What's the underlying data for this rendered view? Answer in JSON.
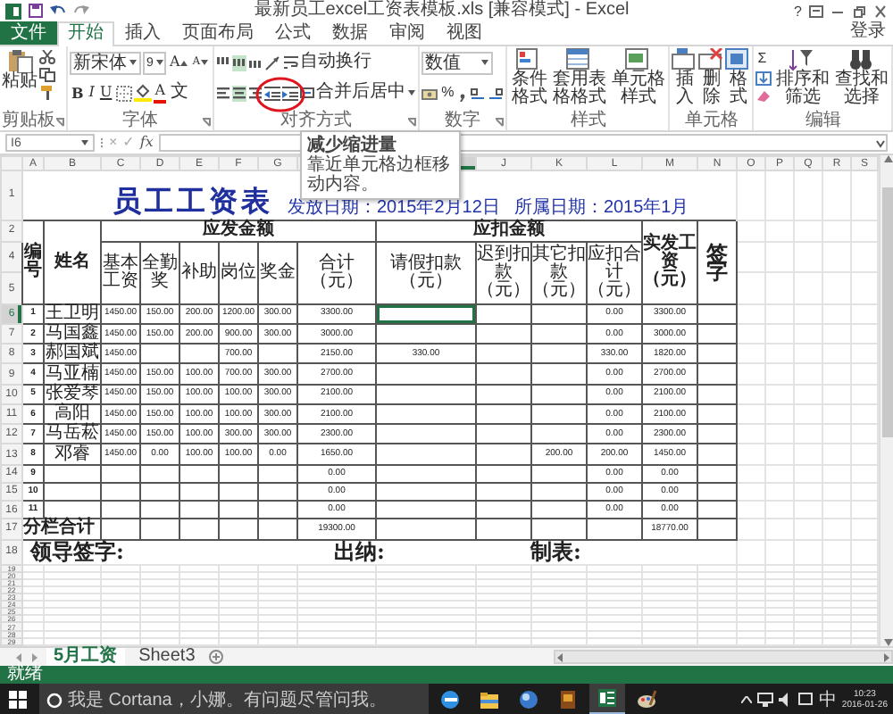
{
  "window": {
    "title": "最新员工excel工资表模板.xls [兼容模式] - Excel",
    "help": "?",
    "sign_in": "登录"
  },
  "ribbon_tabs": [
    {
      "label": "文件",
      "kind": "file",
      "selected": false
    },
    {
      "label": "开始",
      "kind": "tab",
      "selected": true
    },
    {
      "label": "插入",
      "kind": "tab",
      "selected": false
    },
    {
      "label": "页面布局",
      "kind": "tab",
      "selected": false
    },
    {
      "label": "公式",
      "kind": "tab",
      "selected": false
    },
    {
      "label": "数据",
      "kind": "tab",
      "selected": false
    },
    {
      "label": "审阅",
      "kind": "tab",
      "selected": false
    },
    {
      "label": "视图",
      "kind": "tab",
      "selected": false
    }
  ],
  "clipboard": {
    "paste": "粘贴",
    "group": "剪贴板"
  },
  "font": {
    "name": "新宋体",
    "size": "9",
    "grow": "A",
    "shrink": "A",
    "styles": [
      "B",
      "I",
      "U"
    ],
    "color_button": "A",
    "phonetic": "文",
    "group": "字体"
  },
  "alignment": {
    "vertical": [
      {
        "selected": false
      },
      {
        "selected": true
      },
      {
        "selected": false
      }
    ],
    "horizontal": [
      {
        "selected": false
      },
      {
        "selected": true
      },
      {
        "selected": false
      }
    ],
    "wrap": "自动换行",
    "merge": "合并后居中",
    "group": "对齐方式"
  },
  "number": {
    "format": "数值",
    "percent": "%",
    "group": "数字"
  },
  "styles": {
    "buttons": [
      "条件格式",
      "套用表格格式",
      "单元格样式"
    ],
    "group": "样式"
  },
  "cells": {
    "buttons": [
      "插入",
      "删除",
      "格式"
    ],
    "group": "单元格"
  },
  "editing": {
    "sum": "Σ",
    "buttons": [
      "排序和筛选",
      "查找和选择"
    ],
    "group": "编辑"
  },
  "tooltip": {
    "title": "减少缩进量",
    "text": "靠近单元格边框移动内容。"
  },
  "formula_bar": {
    "name_box": "I6",
    "cancel": "×",
    "enter": "✓",
    "fx": "fx"
  },
  "sheet": {
    "columns": [
      {
        "label": "A",
        "selected": false
      },
      {
        "label": "B",
        "selected": false
      },
      {
        "label": "C",
        "selected": false
      },
      {
        "label": "D",
        "selected": false
      },
      {
        "label": "E",
        "selected": false
      },
      {
        "label": "F",
        "selected": false
      },
      {
        "label": "G",
        "selected": false
      },
      {
        "selected": false
      },
      {
        "selected": true
      },
      {
        "label": "J",
        "selected": false
      },
      {
        "label": "K",
        "selected": false
      },
      {
        "label": "L",
        "selected": false
      },
      {
        "label": "M",
        "selected": false
      },
      {
        "label": "N",
        "selected": false
      },
      {
        "label": "O",
        "selected": false
      },
      {
        "label": "P",
        "selected": false
      },
      {
        "label": "Q",
        "selected": false
      },
      {
        "label": "R",
        "selected": false
      },
      {
        "label": "S",
        "selected": false
      }
    ],
    "row_numbers": [
      {
        "label": "1",
        "selected": false
      },
      {
        "label": "2",
        "selected": false
      },
      {
        "label": "4",
        "selected": false
      },
      {
        "label": "5",
        "selected": false
      },
      {
        "label": "6",
        "selected": true
      },
      {
        "label": "7",
        "selected": false
      },
      {
        "label": "8",
        "selected": false
      },
      {
        "label": "9",
        "selected": false
      },
      {
        "label": "10",
        "selected": false
      },
      {
        "label": "11",
        "selected": false
      },
      {
        "label": "12",
        "selected": false
      },
      {
        "label": "13",
        "selected": false
      },
      {
        "label": "14",
        "selected": false
      },
      {
        "label": "15",
        "selected": false
      },
      {
        "label": "16",
        "selected": false
      },
      {
        "label": "17",
        "selected": false
      },
      {
        "label": "18",
        "selected": false
      },
      {
        "label": "19",
        "selected": false
      },
      {
        "label": "20",
        "selected": false
      },
      {
        "label": "21",
        "selected": false
      },
      {
        "label": "22",
        "selected": false
      },
      {
        "label": "23",
        "selected": false
      },
      {
        "label": "24",
        "selected": false
      },
      {
        "label": "25",
        "selected": false
      },
      {
        "label": "26",
        "selected": false
      },
      {
        "label": "27",
        "selected": false
      },
      {
        "label": "28",
        "selected": false
      },
      {
        "label": "29",
        "selected": false
      }
    ],
    "title": "员工工资表",
    "issue_date": "发放日期：2015年2月12日",
    "period": "所属日期：2015年1月",
    "headers": {
      "no": "编号",
      "name": "姓名",
      "gross": "应发金额",
      "deductions": "应扣金额",
      "net": "实发工资（元）",
      "sign": "签字",
      "sub": [
        "基本工资",
        "全勤奖",
        "补助",
        "岗位",
        "奖金",
        "合计（元）",
        "请假扣款（元）",
        "迟到扣款（元）",
        "其它扣款（元）",
        "应扣合计（元）"
      ]
    },
    "rows": [
      {
        "no": "1",
        "name": "王卫明",
        "values": {
          "base": "1450.00",
          "attendance": "150.00",
          "subsidy": "200.00",
          "post": "1200.00",
          "bonus": "300.00",
          "total": "3300.00",
          "deduct_total": "0.00",
          "net": "3300.00"
        }
      },
      {
        "no": "2",
        "name": "马国鑫",
        "values": {
          "base": "1450.00",
          "attendance": "150.00",
          "subsidy": "200.00",
          "post": "900.00",
          "bonus": "300.00",
          "total": "3000.00",
          "deduct_total": "0.00",
          "net": "3000.00"
        }
      },
      {
        "no": "3",
        "name": "郝国斌",
        "values": {
          "base": "1450.00",
          "post": "700.00",
          "total": "2150.00",
          "leave": "330.00",
          "deduct_total": "330.00",
          "net": "1820.00"
        }
      },
      {
        "no": "4",
        "name": "马亚楠",
        "values": {
          "base": "1450.00",
          "attendance": "150.00",
          "subsidy": "100.00",
          "post": "700.00",
          "bonus": "300.00",
          "total": "2700.00",
          "deduct_total": "0.00",
          "net": "2700.00"
        }
      },
      {
        "no": "5",
        "name": "张爱琴",
        "values": {
          "base": "1450.00",
          "attendance": "150.00",
          "subsidy": "100.00",
          "post": "100.00",
          "bonus": "300.00",
          "total": "2100.00",
          "deduct_total": "0.00",
          "net": "2100.00"
        }
      },
      {
        "no": "6",
        "name": "高阳",
        "values": {
          "base": "1450.00",
          "attendance": "150.00",
          "subsidy": "100.00",
          "post": "100.00",
          "bonus": "300.00",
          "total": "2100.00",
          "deduct_total": "0.00",
          "net": "2100.00"
        }
      },
      {
        "no": "7",
        "name": "马岳菘",
        "values": {
          "base": "1450.00",
          "attendance": "150.00",
          "subsidy": "100.00",
          "post": "300.00",
          "bonus": "300.00",
          "total": "2300.00",
          "deduct_total": "0.00",
          "net": "2300.00"
        }
      },
      {
        "no": "8",
        "name": "邓睿",
        "values": {
          "base": "1450.00",
          "attendance": "0.00",
          "subsidy": "100.00",
          "post": "100.00",
          "bonus": "0.00",
          "total": "1650.00",
          "other": "200.00",
          "deduct_total": "200.00",
          "net": "1450.00"
        }
      },
      {
        "no": "9",
        "values": {
          "total": "0.00",
          "deduct_total": "0.00",
          "net": "0.00"
        }
      },
      {
        "no": "10",
        "values": {
          "total": "0.00",
          "deduct_total": "0.00",
          "net": "0.00"
        }
      },
      {
        "no": "11",
        "values": {
          "total": "0.00",
          "deduct_total": "0.00",
          "net": "0.00"
        }
      }
    ],
    "totals": {
      "label": "分栏合计",
      "values": {
        "total": "19300.00",
        "net": "18770.00"
      }
    },
    "signatures": [
      "领导签字:",
      "出纳:",
      "制表:"
    ]
  },
  "sheet_tabs": [
    {
      "label": "5月工资",
      "selected": true
    },
    {
      "label": "Sheet3",
      "selected": false
    }
  ],
  "status_bar": {
    "text": "就绪"
  },
  "taskbar": {
    "search_placeholder": "我是 Cortana，小娜。有问题尽管问我。",
    "apps": [
      {
        "kind": "browser",
        "active": false
      },
      {
        "kind": "folder",
        "active": false
      },
      {
        "kind": "globe",
        "active": false
      },
      {
        "kind": "book",
        "active": false
      },
      {
        "kind": "spreadsheet",
        "active": true
      },
      {
        "kind": "paint",
        "active": false
      }
    ],
    "ime": "中",
    "time": "10:23",
    "date": "2016-01-26"
  }
}
